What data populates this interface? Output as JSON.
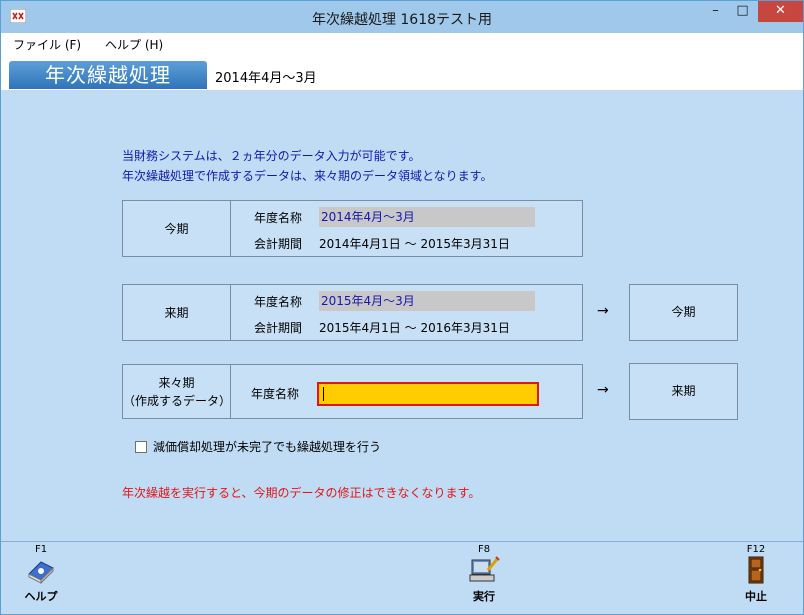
{
  "window": {
    "title": "年次繰越処理 1618テスト用",
    "minimize": "–",
    "maximize": "□",
    "close": "✕"
  },
  "menu": {
    "items": [
      {
        "label": "ファイル (F)"
      },
      {
        "label": "ヘルプ (H)"
      }
    ]
  },
  "header": {
    "tab_title": "年次繰越処理",
    "period": "2014年4月～3月"
  },
  "info": {
    "line1": "当財務システムは、２ヵ年分のデータ入力が可能です。",
    "line2": "年次繰越処理で作成するデータは、来々期のデータ領域となります。"
  },
  "current_period": {
    "label": "今期",
    "name_label": "年度名称",
    "name_value": "2014年4月～3月",
    "term_label": "会計期間",
    "term_value": "2014年4月1日 ～ 2015年3月31日"
  },
  "next_period": {
    "label": "来期",
    "name_label": "年度名称",
    "name_value": "2015年4月～3月",
    "term_label": "会計期間",
    "term_value": "2015年4月1日 ～ 2016年3月31日",
    "arrow": "→",
    "target": "今期"
  },
  "after_next_period": {
    "label_line1": "来々期",
    "label_line2": "（作成するデータ）",
    "name_label": "年度名称",
    "name_value": "",
    "arrow": "→",
    "target": "来期"
  },
  "options": {
    "depreciation_checkbox_label": "減価償却処理が未完了でも繰越処理を行う",
    "depreciation_checked": false
  },
  "warning": "年次繰越を実行すると、今期のデータの修正はできなくなります。",
  "footer": {
    "keys": [
      {
        "key": "F1",
        "label": "ヘルプ",
        "icon": "help-book-icon"
      },
      {
        "key": "F8",
        "label": "実行",
        "icon": "execute-computer-icon"
      },
      {
        "key": "F12",
        "label": "中止",
        "icon": "door-exit-icon"
      }
    ]
  },
  "colors": {
    "background": "#bfdcf4",
    "header_tab": "#3d85c6",
    "info_text": "#1515b0",
    "warning_text": "#e01515",
    "input_fill": "#ffcc00",
    "input_border": "#e01515",
    "close_button": "#c7463f"
  }
}
